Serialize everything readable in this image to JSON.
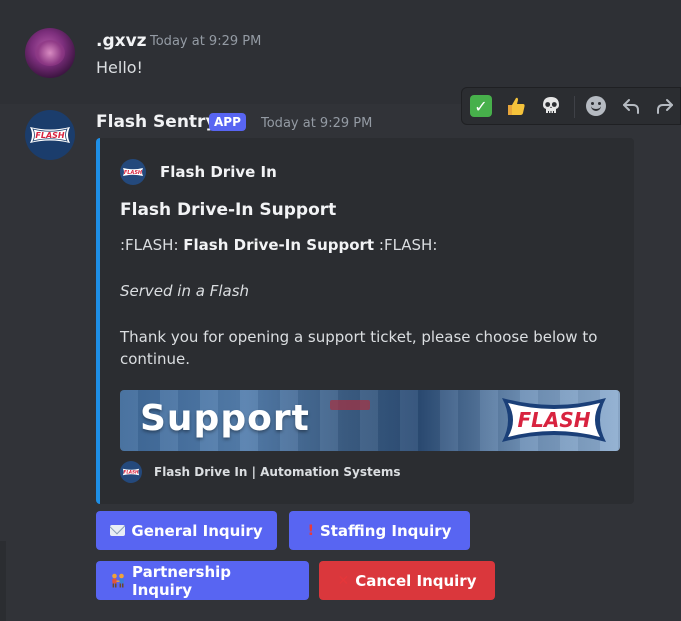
{
  "messages": [
    {
      "username": ".gxvz",
      "timestamp": "Today at 9:29 PM",
      "content": "Hello!"
    },
    {
      "username": "Flash Sentry",
      "tag": "APP",
      "timestamp": "Today at 9:29 PM"
    }
  ],
  "toolbar": {
    "icons": [
      "check-mark-emoji",
      "thumbs-up-emoji",
      "skull-emoji",
      "add-reaction-icon",
      "reply-icon",
      "forward-icon"
    ]
  },
  "embed": {
    "accent_color": "#1e8fe6",
    "author": "Flash Drive In",
    "title": "Flash Drive-In Support",
    "line1_prefix": ":FLASH:",
    "line1_bold": "Flash Drive-In Support",
    "line1_suffix": ":FLASH:",
    "italic": "Served in a Flash",
    "description": "Thank you for opening a support ticket, please choose below to continue.",
    "image": {
      "support_text": "Support",
      "logo_text": "FLASH"
    },
    "logo_text": "FLASH",
    "footer": "Flash Drive In | Automation Systems"
  },
  "buttons": [
    {
      "label": "General Inquiry",
      "icon": "envelope-icon",
      "color": "#5865f2"
    },
    {
      "label": "Staffing Inquiry",
      "icon": "exclamation-icon",
      "color": "#5865f2"
    },
    {
      "label": "Partnership Inquiry",
      "icon": "people-holding-hands-icon",
      "color": "#5865f2"
    },
    {
      "label": "Cancel Inquiry",
      "icon": "cross-mark-icon",
      "color": "#da373c"
    }
  ]
}
